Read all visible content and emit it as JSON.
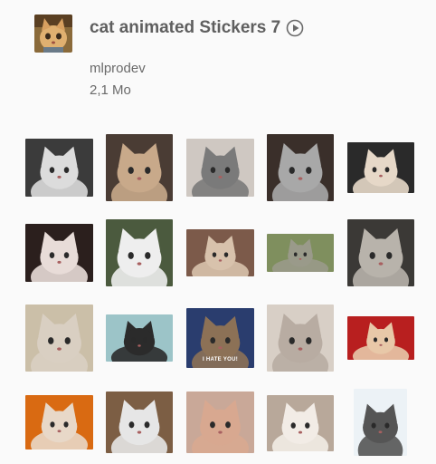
{
  "pack": {
    "title": "cat animated Stickers 7",
    "publisher": "mlprodev",
    "size": "2,1 Mo",
    "icon": "cat-pack-icon",
    "play_icon": "play-circle-icon"
  },
  "stickers": [
    {
      "name": "sticker-fluffy-white-cat",
      "bg": "#3b3b3b",
      "cat": "#dcdcdc"
    },
    {
      "name": "sticker-tabby-cat-face",
      "bg": "#4a3c34",
      "cat": "#c8a98a"
    },
    {
      "name": "sticker-grey-cat-yawning",
      "bg": "#cfc8c2",
      "cat": "#7a7a7a"
    },
    {
      "name": "sticker-cat-in-beanie",
      "bg": "#3a2f2a",
      "cat": "#a8a8a8"
    },
    {
      "name": "sticker-cat-pouncing",
      "bg": "#2a2a2a",
      "cat": "#e6d8c8"
    },
    {
      "name": "sticker-white-cat-mouth-open",
      "bg": "#2b1f1d",
      "cat": "#e8dcd8"
    },
    {
      "name": "sticker-white-cat-lying",
      "bg": "#4b5a3e",
      "cat": "#eeeeee"
    },
    {
      "name": "sticker-grumpy-cat",
      "bg": "#7c5a4a",
      "cat": "#d8c2ac"
    },
    {
      "name": "sticker-cat-in-sunglasses",
      "bg": "#7f8f5e",
      "cat": "#9a9a8a"
    },
    {
      "name": "sticker-grey-white-cat",
      "bg": "#3b3936",
      "cat": "#b8b3ab"
    },
    {
      "name": "sticker-cat-on-bed",
      "bg": "#cbbfa8",
      "cat": "#d9cfc2"
    },
    {
      "name": "sticker-cartoon-tom-cat",
      "bg": "#9cc4c8",
      "cat": "#2b2b2b"
    },
    {
      "name": "sticker-i-hate-you-cat",
      "bg": "#2a3d6e",
      "cat": "#8c7156",
      "caption": "I HATE YOU!"
    },
    {
      "name": "sticker-chubby-grey-cat",
      "bg": "#d8cfc6",
      "cat": "#b8aca2"
    },
    {
      "name": "sticker-cat-sleeping",
      "bg": "#b81f1f",
      "cat": "#e8c8a8"
    },
    {
      "name": "sticker-cat-by-fire",
      "bg": "#d96a12",
      "cat": "#e8d8c8"
    },
    {
      "name": "sticker-cats-dancing",
      "bg": "#7c5e44",
      "cat": "#e6e6e6"
    },
    {
      "name": "sticker-sphynx-cat-in-sweater",
      "bg": "#c9a898",
      "cat": "#d8a890"
    },
    {
      "name": "sticker-white-kitten-eating",
      "bg": "#b8a89a",
      "cat": "#f2ece6"
    },
    {
      "name": "sticker-cat-dancing-standing",
      "bg": "#ecf2f6",
      "cat": "#555555"
    }
  ]
}
